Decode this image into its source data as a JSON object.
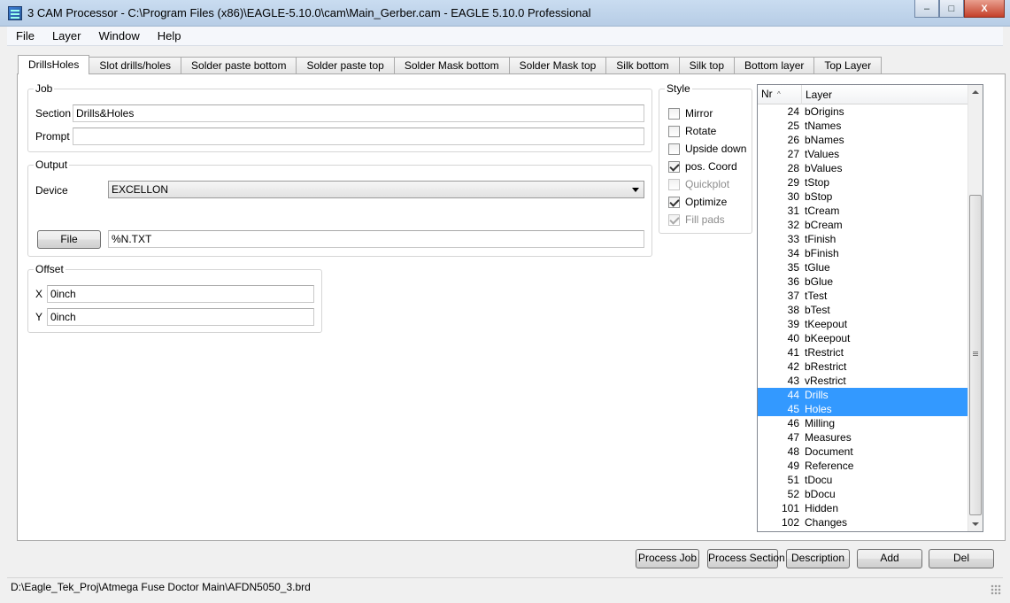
{
  "window": {
    "title": "3 CAM Processor - C:\\Program Files (x86)\\EAGLE-5.10.0\\cam\\Main_Gerber.cam - EAGLE 5.10.0 Professional",
    "controls": [
      "–",
      "□",
      "X"
    ]
  },
  "menu": [
    "File",
    "Layer",
    "Window",
    "Help"
  ],
  "tabs": [
    "DrillsHoles",
    "Slot drills/holes",
    "Solder paste bottom",
    "Solder paste top",
    "Solder Mask bottom",
    "Solder Mask top",
    "Silk bottom",
    "Silk top",
    "Bottom layer",
    "Top Layer"
  ],
  "job": {
    "legend": "Job",
    "section_label": "Section",
    "section_value": "Drills&Holes",
    "prompt_label": "Prompt",
    "prompt_value": ""
  },
  "output": {
    "legend": "Output",
    "device_label": "Device",
    "device_value": "EXCELLON",
    "file_button": "File",
    "file_value": "%N.TXT"
  },
  "offset": {
    "legend": "Offset",
    "x_label": "X",
    "x_value": "0inch",
    "y_label": "Y",
    "y_value": "0inch"
  },
  "style": {
    "legend": "Style",
    "options": [
      {
        "label": "Mirror",
        "checked": false,
        "disabled": false
      },
      {
        "label": "Rotate",
        "checked": false,
        "disabled": false
      },
      {
        "label": "Upside down",
        "checked": false,
        "disabled": false
      },
      {
        "label": "pos. Coord",
        "checked": true,
        "disabled": false
      },
      {
        "label": "Quickplot",
        "checked": false,
        "disabled": true
      },
      {
        "label": "Optimize",
        "checked": true,
        "disabled": false
      },
      {
        "label": "Fill pads",
        "checked": true,
        "disabled": true
      }
    ]
  },
  "layers": {
    "col_nr": "Nr",
    "col_layer": "Layer",
    "rows": [
      {
        "nr": "24",
        "name": "bOrigins"
      },
      {
        "nr": "25",
        "name": "tNames"
      },
      {
        "nr": "26",
        "name": "bNames"
      },
      {
        "nr": "27",
        "name": "tValues"
      },
      {
        "nr": "28",
        "name": "bValues"
      },
      {
        "nr": "29",
        "name": "tStop"
      },
      {
        "nr": "30",
        "name": "bStop"
      },
      {
        "nr": "31",
        "name": "tCream"
      },
      {
        "nr": "32",
        "name": "bCream"
      },
      {
        "nr": "33",
        "name": "tFinish"
      },
      {
        "nr": "34",
        "name": "bFinish"
      },
      {
        "nr": "35",
        "name": "tGlue"
      },
      {
        "nr": "36",
        "name": "bGlue"
      },
      {
        "nr": "37",
        "name": "tTest"
      },
      {
        "nr": "38",
        "name": "bTest"
      },
      {
        "nr": "39",
        "name": "tKeepout"
      },
      {
        "nr": "40",
        "name": "bKeepout"
      },
      {
        "nr": "41",
        "name": "tRestrict"
      },
      {
        "nr": "42",
        "name": "bRestrict"
      },
      {
        "nr": "43",
        "name": "vRestrict"
      },
      {
        "nr": "44",
        "name": "Drills",
        "selected": true
      },
      {
        "nr": "45",
        "name": "Holes",
        "selected": true
      },
      {
        "nr": "46",
        "name": "Milling"
      },
      {
        "nr": "47",
        "name": "Measures"
      },
      {
        "nr": "48",
        "name": "Document"
      },
      {
        "nr": "49",
        "name": "Reference"
      },
      {
        "nr": "51",
        "name": "tDocu"
      },
      {
        "nr": "52",
        "name": "bDocu"
      },
      {
        "nr": "101",
        "name": "Hidden"
      },
      {
        "nr": "102",
        "name": "Changes"
      }
    ]
  },
  "actions": {
    "process_job": "Process Job",
    "process_section": "Process Section",
    "description": "Description",
    "add": "Add",
    "del": "Del"
  },
  "status": {
    "path": "D:\\Eagle_Tek_Proj\\Atmega Fuse Doctor Main\\AFDN5050_3.brd"
  }
}
